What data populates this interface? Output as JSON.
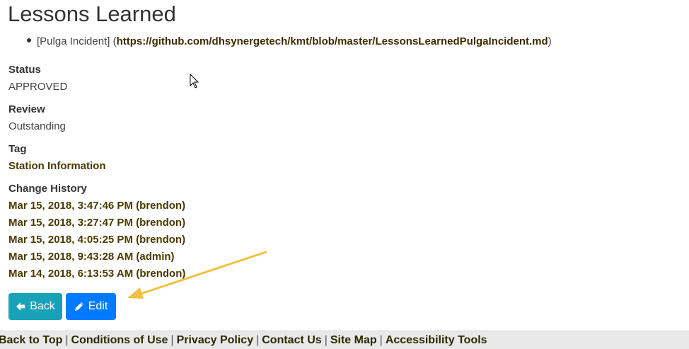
{
  "page": {
    "title": "Lessons Learned"
  },
  "reference": {
    "label": "[Pulga Incident]",
    "open_paren": " (",
    "url": "https://github.com/dhsynergetech/kmt/blob/master/LessonsLearnedPulgaIncident.md",
    "close_paren": ")"
  },
  "fields": {
    "status_label": "Status",
    "status_value": "APPROVED",
    "review_label": "Review",
    "review_value": "Outstanding",
    "tag_label": "Tag",
    "tag_value": "Station Information",
    "history_label": "Change History"
  },
  "history": [
    "Mar 15, 2018, 3:47:46 PM (brendon)",
    "Mar 15, 2018, 3:27:47 PM (brendon)",
    "Mar 15, 2018, 4:05:25 PM (brendon)",
    "Mar 15, 2018, 9:43:28 AM (admin)",
    "Mar 14, 2018, 6:13:53 AM (brendon)"
  ],
  "buttons": {
    "back_label": "Back",
    "back_icon": "arrow-left-icon",
    "edit_label": "Edit",
    "edit_icon": "pencil-icon"
  },
  "footer": {
    "links": [
      "Back to Top",
      "Conditions of Use",
      "Privacy Policy",
      "Contact Us",
      "Site Map",
      "Accessibility Tools"
    ],
    "separator": "|"
  },
  "colors": {
    "back_button": "#17a2b8",
    "edit_button": "#007bff",
    "link_text": "#4a3a00",
    "annotation_arrow": "#f0c040",
    "footer_bg": "#e9e9e9"
  }
}
